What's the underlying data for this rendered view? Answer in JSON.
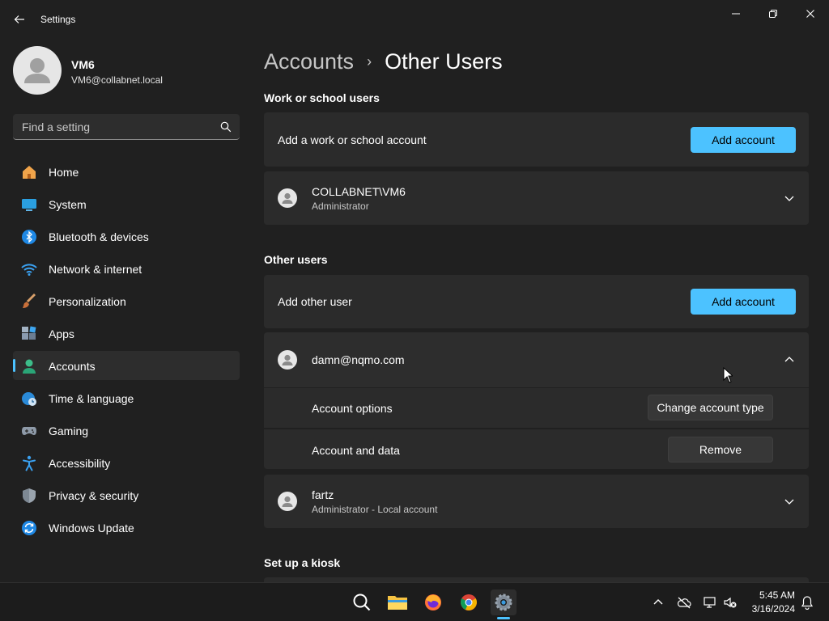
{
  "window": {
    "title": "Settings"
  },
  "profile": {
    "name": "VM6",
    "email": "VM6@collabnet.local"
  },
  "search": {
    "placeholder": "Find a setting"
  },
  "sidebar": {
    "items": [
      {
        "label": "Home",
        "icon": "home-icon",
        "active": false
      },
      {
        "label": "System",
        "icon": "system-icon",
        "active": false
      },
      {
        "label": "Bluetooth & devices",
        "icon": "bluetooth-icon",
        "active": false
      },
      {
        "label": "Network & internet",
        "icon": "wifi-icon",
        "active": false
      },
      {
        "label": "Personalization",
        "icon": "brush-icon",
        "active": false
      },
      {
        "label": "Apps",
        "icon": "apps-icon",
        "active": false
      },
      {
        "label": "Accounts",
        "icon": "accounts-icon",
        "active": true
      },
      {
        "label": "Time & language",
        "icon": "globe-clock-icon",
        "active": false
      },
      {
        "label": "Gaming",
        "icon": "gamepad-icon",
        "active": false
      },
      {
        "label": "Accessibility",
        "icon": "accessibility-icon",
        "active": false
      },
      {
        "label": "Privacy & security",
        "icon": "shield-icon",
        "active": false
      },
      {
        "label": "Windows Update",
        "icon": "update-icon",
        "active": false
      }
    ]
  },
  "breadcrumb": {
    "parent": "Accounts",
    "separator": "›",
    "current": "Other Users"
  },
  "work_section": {
    "title": "Work or school users",
    "add_label": "Add a work or school account",
    "add_button": "Add account",
    "user": {
      "name": "COLLABNET\\VM6",
      "role": "Administrator"
    }
  },
  "other_section": {
    "title": "Other users",
    "add_label": "Add other user",
    "add_button": "Add account",
    "expanded_user": {
      "name": "damn@nqmo.com",
      "options_label": "Account options",
      "options_button": "Change account type",
      "data_label": "Account and data",
      "data_button": "Remove"
    },
    "user2": {
      "name": "fartz",
      "role": "Administrator - Local account"
    }
  },
  "kiosk_section": {
    "title": "Set up a kiosk"
  },
  "taskbar": {
    "time": "5:45 AM",
    "date": "3/16/2024"
  },
  "colors": {
    "accent": "#4cc2ff",
    "background": "#202020",
    "card": "#2b2b2b"
  }
}
